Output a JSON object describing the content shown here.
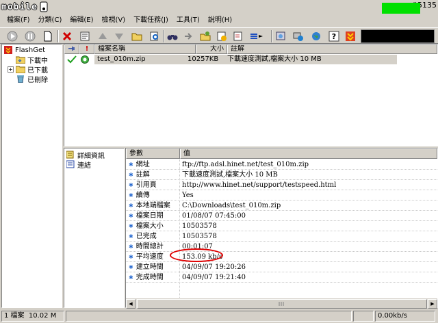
{
  "title": {
    "logo": "mobile",
    "watermark": "#5135"
  },
  "menu": [
    "檔案(F)",
    "分類(C)",
    "編輯(E)",
    "檢視(V)",
    "下載任務(J)",
    "工具(T)",
    "說明(H)"
  ],
  "toolbar": {
    "icons": [
      "start-icon",
      "pause-icon",
      "new-icon",
      "delete-icon",
      "properties-icon",
      "move-up-icon",
      "move-down-icon",
      "open-folder-icon",
      "find-icon",
      "binoculars-icon",
      "import-icon",
      "options-icon",
      "schedule-icon",
      "tasks-icon",
      "connection-icon",
      "globe-icon",
      "help-icon",
      "exit-icon"
    ]
  },
  "categories": {
    "root": "FlashGet",
    "items": [
      "下載中",
      "已下載",
      "已刪除"
    ]
  },
  "file_list": {
    "columns": [
      "",
      "!",
      "檔案名稱",
      "大小",
      "註解"
    ],
    "rows": [
      {
        "name": "test_010m.zip",
        "size": "10257KB",
        "comment": "下載速度測試,檔案大小 10 MB"
      }
    ]
  },
  "details_nav": [
    "詳細資訊",
    "連結"
  ],
  "info": {
    "header_key": "參數",
    "header_value": "值",
    "rows": [
      {
        "key": "網址",
        "value": "ftp://ftp.adsl.hinet.net/test_010m.zip"
      },
      {
        "key": "註解",
        "value": "下載速度測試,檔案大小 10 MB"
      },
      {
        "key": "引用頁",
        "value": "http://www.hinet.net/support/testspeed.html"
      },
      {
        "key": "續傳",
        "value": "Yes"
      },
      {
        "key": "本地端檔案",
        "value": "C:\\Downloads\\test_010m.zip"
      },
      {
        "key": "檔案日期",
        "value": "01/08/07 07:45:00"
      },
      {
        "key": "檔案大小",
        "value": "10503578"
      },
      {
        "key": "已完成",
        "value": "10503578"
      },
      {
        "key": "時間總計",
        "value": "00:01:07"
      },
      {
        "key": "平均速度",
        "value": "153.09 kb/s"
      },
      {
        "key": "建立時間",
        "value": "04/09/07 19:20:26"
      },
      {
        "key": "完成時間",
        "value": "04/09/07 19:21:40"
      }
    ]
  },
  "status": {
    "count": "1 檔案",
    "size": "10.02 M",
    "speed": "0.00kb/s"
  },
  "colors": {
    "meter_fill": "#00e000",
    "highlight": "#e00000",
    "bullet": "#2a6bd0"
  }
}
